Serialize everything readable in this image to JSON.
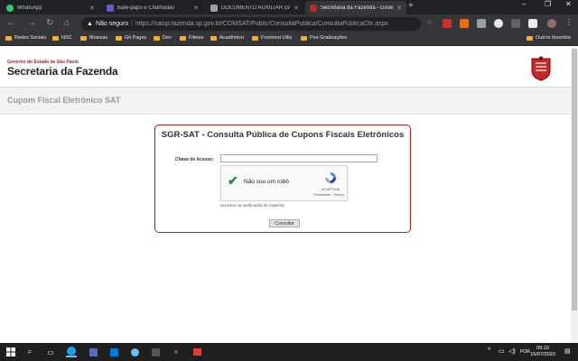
{
  "browser": {
    "tabs": [
      {
        "title": "WhatsApp",
        "icon": "whatsapp-icon",
        "color": "#25d366"
      },
      {
        "title": "Bate-papo e Chamadas",
        "icon": "teams-icon",
        "color": "#5b5fc7"
      },
      {
        "title": "DOCUMENTO AUXILIAR DA NO...",
        "icon": "document-icon",
        "color": "#9aa0a6"
      },
      {
        "title": "Secretaria da Fazenda - Governo...",
        "icon": "sefaz-icon",
        "color": "#c62828"
      }
    ],
    "security_label": "Não seguro",
    "url": "https://satsp.fazenda.sp.gov.br/COMSAT/Public/ConsultaPublica/ConsultaPublicaCfe.aspx",
    "bookmarks": [
      "Redes Sociais",
      "NSC",
      "Musicas",
      "Git Pages",
      "Dev",
      "Filmes",
      "Acadêmico",
      "Frontend Utils",
      "Pos Graduações"
    ],
    "other_bookmarks": "Outros favoritos"
  },
  "page": {
    "gov_line": "Governo do Estado de São Paulo",
    "org_name": "Secretaria da Fazenda",
    "section_title": "Cupom Fiscal Eletrônico SAT",
    "panel_title": "SGR-SAT - Consulta Pública de Cupons Fiscais Eletrônicos",
    "access_key_label": "Chave de Acesso:",
    "access_key_value": "",
    "captcha": {
      "label": "Não sou um robô",
      "brand": "reCAPTCHA",
      "links": "Privacidade - Termos",
      "checked": true
    },
    "captcha_status": "Sucesso na verificação do Captcha",
    "submit_label": "Consultar"
  },
  "taskbar": {
    "time": "09:10",
    "date": "16/07/2020"
  },
  "colors": {
    "brand_red": "#b71c1c",
    "chrome_dark": "#202124",
    "chrome_toolbar": "#35363a"
  }
}
